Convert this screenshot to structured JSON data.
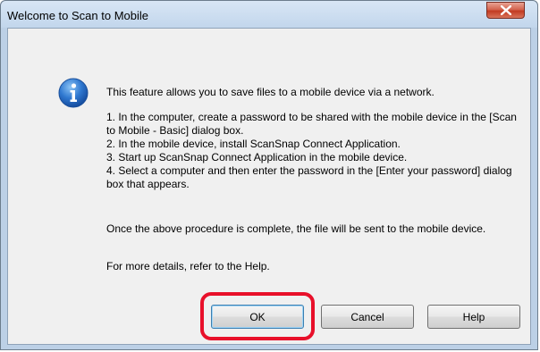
{
  "window": {
    "title": "Welcome to Scan to Mobile"
  },
  "icons": {
    "info": "info-icon",
    "close": "close-icon"
  },
  "message": {
    "intro": "This feature allows you to save files to a mobile device via a network.",
    "steps": [
      "1. In the computer, create a password to be shared with the mobile device in the [Scan to Mobile - Basic] dialog box.",
      "2. In the mobile device, install ScanSnap Connect Application.",
      "3. Start up ScanSnap Connect Application in the mobile device.",
      "4. Select a computer and then enter the password in the [Enter your password] dialog box that appears."
    ],
    "complete": "Once the above procedure is complete, the file will be sent to the mobile device.",
    "details": "For more details, refer to the Help."
  },
  "buttons": {
    "ok": "OK",
    "cancel": "Cancel",
    "help": "Help"
  },
  "colors": {
    "highlight": "#e8102a",
    "close_button": "#c23b22",
    "info_icon": "#1f5fb4"
  }
}
